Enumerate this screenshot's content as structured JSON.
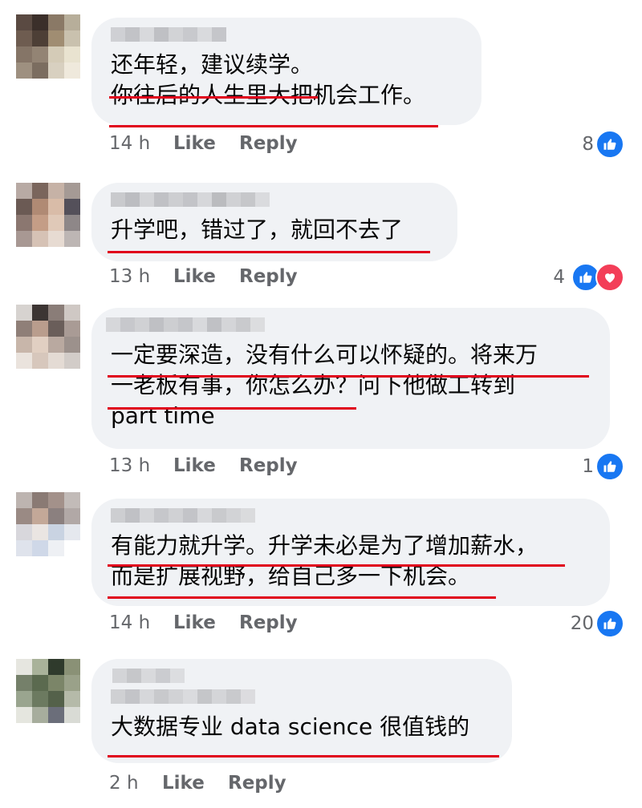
{
  "comments": [
    {
      "lines": [
        "还年轻，建议续学。",
        "你往后的人生里大把机会工作。"
      ],
      "time": "14 h",
      "like": "Like",
      "reply": "Reply",
      "count": "8",
      "reactions": [
        "like-icon"
      ]
    },
    {
      "lines": [
        "升学吧，错过了，就回不去了"
      ],
      "time": "13 h",
      "like": "Like",
      "reply": "Reply",
      "count": "4",
      "reactions": [
        "like-icon",
        "love-icon"
      ]
    },
    {
      "lines": [
        "一定要深造，没有什么可以怀疑的。将来万",
        "一老板有事，你怎么办？问下他做工转到",
        "part time"
      ],
      "time": "13 h",
      "like": "Like",
      "reply": "Reply",
      "count": "1",
      "reactions": [
        "like-icon"
      ]
    },
    {
      "lines": [
        "有能力就升学。升学未必是为了增加薪水，",
        "而是扩展视野，给自己多一下机会。"
      ],
      "time": "14 h",
      "like": "Like",
      "reply": "Reply",
      "count": "20",
      "reactions": [
        "like-icon"
      ]
    },
    {
      "lines": [
        "大数据专业 data science 很值钱的"
      ],
      "time": "2 h",
      "like": "Like",
      "reply": "Reply",
      "count": "",
      "reactions": []
    }
  ],
  "colors": {
    "underline": "#e0001b",
    "like": "#1877f2",
    "love": "#f33e58",
    "bubble": "#f0f2f5",
    "meta": "#65676b"
  }
}
